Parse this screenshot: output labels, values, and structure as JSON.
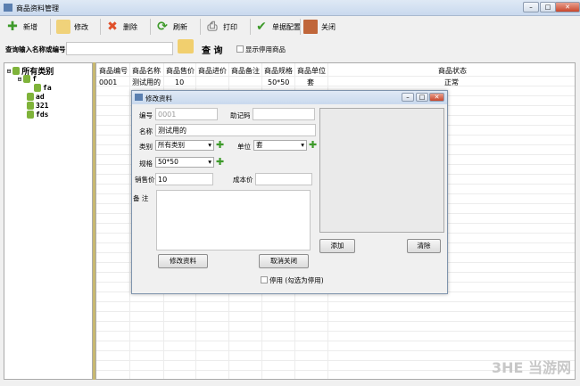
{
  "window": {
    "title": "商品资料管理"
  },
  "toolbar": {
    "items": [
      {
        "label": "新增",
        "icon": "plus-icon"
      },
      {
        "label": "修改",
        "icon": "edit-icon"
      },
      {
        "label": "删除",
        "icon": "delete-icon"
      },
      {
        "label": "刷新",
        "icon": "refresh-icon"
      },
      {
        "label": "打印",
        "icon": "print-icon"
      },
      {
        "label": "单据配置",
        "icon": "config-icon"
      },
      {
        "label": "关闭",
        "icon": "exit-icon"
      }
    ]
  },
  "search": {
    "label": "查询输入名称或编号:",
    "value": "",
    "button": "查 询",
    "show_disabled": "显示停用商品"
  },
  "tree": {
    "root": "所有类别",
    "children": [
      "f",
      "fa",
      "ad",
      "321",
      "fds"
    ]
  },
  "grid": {
    "headers": [
      "商品编号",
      "商品名称",
      "商品售价",
      "商品进价",
      "商品备注",
      "商品规格",
      "商品单位",
      "商品状态"
    ],
    "rows": [
      [
        "0001",
        "测试用的",
        "10",
        "",
        "",
        "50*50",
        "套",
        "正常"
      ]
    ]
  },
  "dialog": {
    "title": "修改资料",
    "code_label": "编号",
    "code_value": "0001",
    "mnemonic_label": "助记码",
    "mnemonic_value": "",
    "name_label": "名称",
    "name_value": "测试用的",
    "category_label": "类别",
    "category_value": "所有类别",
    "unit_label": "单位",
    "unit_value": "套",
    "spec_label": "规格",
    "spec_value": "50*50",
    "price_label": "销售价",
    "price_value": "10",
    "cost_label": "成本价",
    "cost_value": "",
    "note_label": "备 注",
    "note_value": "",
    "add_image": "添加",
    "clear_image": "清除",
    "save": "修改资料",
    "cancel": "取消关闭",
    "disable": "停用 (勾选为停用)"
  },
  "watermark": "3HE 当游网"
}
